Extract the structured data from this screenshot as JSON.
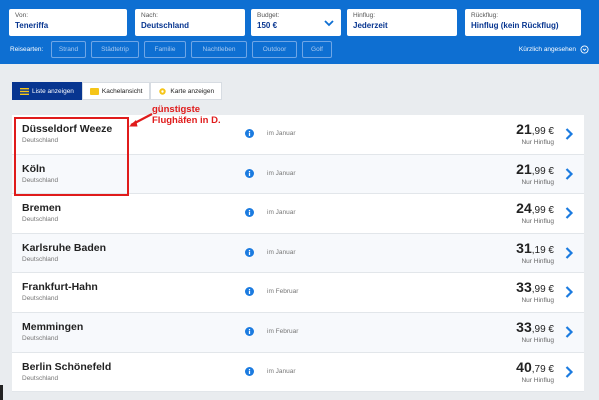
{
  "search": {
    "from_label": "Von:",
    "from_value": "Teneriffa",
    "to_label": "Nach:",
    "to_value": "Deutschland",
    "budget_label": "Budget:",
    "budget_value": "150 €",
    "outbound_label": "Hinflug:",
    "outbound_value": "Jederzeit",
    "return_label": "Rückflug:",
    "return_value": "Hinflug (kein Rückflug)"
  },
  "filters": {
    "label": "Reisearten:",
    "items": [
      "Strand",
      "Städtetrip",
      "Familie",
      "Nachtleben",
      "Outdoor",
      "Golf"
    ],
    "recent": "Kürzlich angesehen"
  },
  "views": {
    "list": "Liste anzeigen",
    "tiles": "Kachelansicht",
    "map": "Karte anzeigen"
  },
  "annotation": {
    "line1": "günstigste",
    "line2": "Flughäfen in D."
  },
  "results": [
    {
      "city": "Düsseldorf Weeze",
      "country": "Deutschland",
      "month": "im Januar",
      "price_int": "21",
      "price_dec": ",99 €",
      "fare": "Nur Hinflug"
    },
    {
      "city": "Köln",
      "country": "Deutschland",
      "month": "im Januar",
      "price_int": "21",
      "price_dec": ",99 €",
      "fare": "Nur Hinflug"
    },
    {
      "city": "Bremen",
      "country": "Deutschland",
      "month": "im Januar",
      "price_int": "24",
      "price_dec": ",99 €",
      "fare": "Nur Hinflug"
    },
    {
      "city": "Karlsruhe Baden",
      "country": "Deutschland",
      "month": "im Januar",
      "price_int": "31",
      "price_dec": ",19 €",
      "fare": "Nur Hinflug"
    },
    {
      "city": "Frankfurt-Hahn",
      "country": "Deutschland",
      "month": "im Februar",
      "price_int": "33",
      "price_dec": ",99 €",
      "fare": "Nur Hinflug"
    },
    {
      "city": "Memmingen",
      "country": "Deutschland",
      "month": "im Februar",
      "price_int": "33",
      "price_dec": ",99 €",
      "fare": "Nur Hinflug"
    },
    {
      "city": "Berlin Schönefeld",
      "country": "Deutschland",
      "month": "im Januar",
      "price_int": "40",
      "price_dec": ",79 €",
      "fare": "Nur Hinflug"
    }
  ],
  "colors": {
    "brand": "#0e6fd2",
    "dark": "#073590",
    "annotation": "#e01b1b"
  }
}
